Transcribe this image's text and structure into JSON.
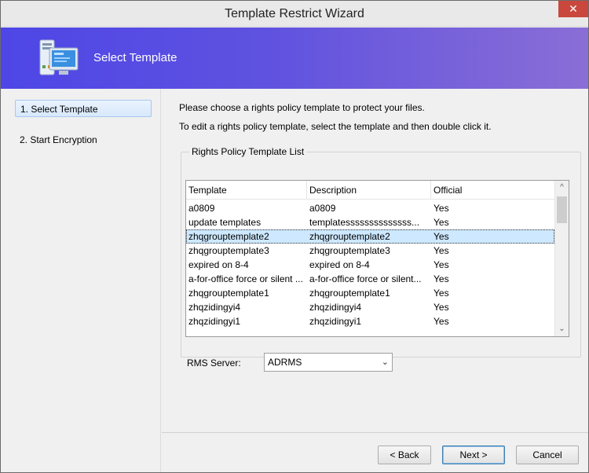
{
  "window": {
    "title": "Template Restrict Wizard",
    "close_glyph": "✕"
  },
  "banner": {
    "heading": "Select Template",
    "icon": "computer-icon"
  },
  "nav": {
    "items": [
      {
        "label": "1. Select Template",
        "active": true
      },
      {
        "label": "2. Start Encryption",
        "active": false
      }
    ]
  },
  "main": {
    "instruction1": "Please choose a rights policy template to protect your files.",
    "instruction2": "To edit a rights policy template, select the template and then double click it.",
    "group_title": "Rights Policy Template List",
    "columns": [
      "Template",
      "Description",
      "Official"
    ],
    "rows": [
      [
        "a0809",
        "a0809",
        "Yes"
      ],
      [
        "update templates",
        "templatessssssssssssss...",
        "Yes"
      ],
      [
        "zhqgrouptemplate2",
        "zhqgrouptemplate2",
        "Yes"
      ],
      [
        "zhqgrouptemplate3",
        "zhqgrouptemplate3",
        "Yes"
      ],
      [
        "expired on 8-4",
        "expired on 8-4",
        "Yes"
      ],
      [
        "a-for-office force or silent ...",
        "a-for-office force or silent...",
        "Yes"
      ],
      [
        "zhqgrouptemplate1",
        "zhqgrouptemplate1",
        "Yes"
      ],
      [
        "zhqzidingyi4",
        "zhqzidingyi4",
        "Yes"
      ],
      [
        "zhqzidingyi1",
        "zhqzidingyi1",
        "Yes"
      ]
    ],
    "selected_row": 2,
    "rms_label": "RMS Server:",
    "rms_value": "ADRMS"
  },
  "buttons": {
    "back": "< Back",
    "next": "Next >",
    "cancel": "Cancel"
  },
  "colors": {
    "banner_start": "#4e46e6",
    "banner_end": "#8a6ed6",
    "close_button": "#c9473d",
    "selection": "#cde8ff"
  }
}
